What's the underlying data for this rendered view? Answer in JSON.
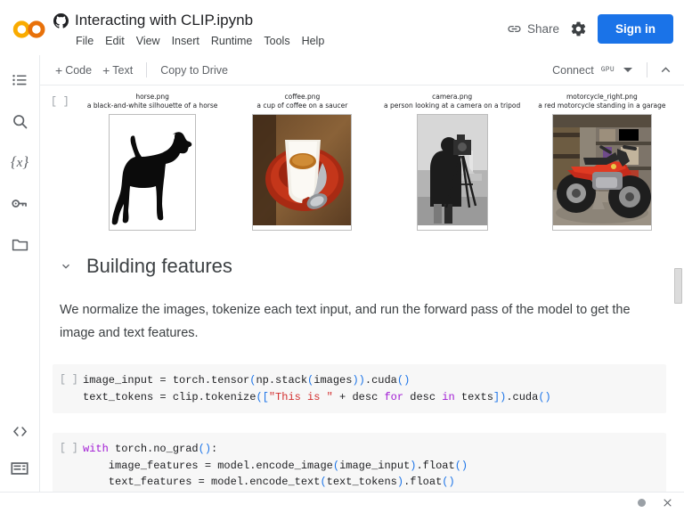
{
  "app": {
    "logo_name": "colab-logo",
    "accent_blue": "#1a73e8",
    "logo_orange": "#f9ab00"
  },
  "header": {
    "doc_title": "Interacting with CLIP.ipynb",
    "github_icon": "github-icon",
    "menus": [
      "File",
      "Edit",
      "View",
      "Insert",
      "Runtime",
      "Tools",
      "Help"
    ],
    "share_label": "Share",
    "share_icon": "link-icon",
    "settings_icon": "gear-icon",
    "signin_label": "Sign in"
  },
  "toolbar": {
    "add_code_label": "Code",
    "add_text_label": "Text",
    "plus_symbol": "+",
    "copy_to_drive_label": "Copy to Drive",
    "connect_label": "Connect",
    "gpu_badge": "GPU",
    "dropdown_icon": "chevron-down-icon",
    "collapse_icon": "chevron-up-icon"
  },
  "sidebar": {
    "items": [
      {
        "name": "table-of-contents-icon",
        "label": "Table of contents"
      },
      {
        "name": "search-icon",
        "label": "Search"
      },
      {
        "name": "variables-icon",
        "label": "Variables"
      },
      {
        "name": "secrets-key-icon",
        "label": "Secrets"
      },
      {
        "name": "files-folder-icon",
        "label": "Files"
      }
    ],
    "bottom_items": [
      {
        "name": "code-snippets-icon",
        "label": "Code snippets"
      },
      {
        "name": "terminal-icon",
        "label": "Terminal"
      }
    ]
  },
  "notebook": {
    "output_cell": {
      "prompt": "[ ]",
      "images": [
        {
          "filename": "horse.png",
          "caption": "a black-and-white silhouette of a horse",
          "kind": "horse-silhouette"
        },
        {
          "filename": "coffee.png",
          "caption": "a cup of coffee on a saucer",
          "kind": "coffee-cup"
        },
        {
          "filename": "camera.png",
          "caption": "a person looking at a camera on a tripod",
          "kind": "camera-person"
        },
        {
          "filename": "motorcycle_right.png",
          "caption": "a red motorcycle standing in a garage",
          "kind": "motorcycle"
        }
      ]
    },
    "markdown_section": {
      "collapse_icon": "chevron-down-icon",
      "heading": "Building features",
      "paragraph": "We normalize the images, tokenize each text input, and run the forward pass of the model to get the image and text features."
    },
    "code_cells": [
      {
        "prompt": "[ ]",
        "lines": [
          [
            {
              "t": "image_input = torch.tensor",
              "c": "plain"
            },
            {
              "t": "(",
              "c": "paren"
            },
            {
              "t": "np.stack",
              "c": "plain"
            },
            {
              "t": "(",
              "c": "paren"
            },
            {
              "t": "images",
              "c": "plain"
            },
            {
              "t": "))",
              "c": "paren"
            },
            {
              "t": ".cuda",
              "c": "plain"
            },
            {
              "t": "()",
              "c": "paren"
            }
          ],
          [
            {
              "t": "text_tokens = clip.tokenize",
              "c": "plain"
            },
            {
              "t": "([",
              "c": "paren"
            },
            {
              "t": "\"This is \"",
              "c": "string"
            },
            {
              "t": " + desc ",
              "c": "plain"
            },
            {
              "t": "for",
              "c": "keyword"
            },
            {
              "t": " desc ",
              "c": "plain"
            },
            {
              "t": "in",
              "c": "keyword"
            },
            {
              "t": " texts",
              "c": "plain"
            },
            {
              "t": "])",
              "c": "paren"
            },
            {
              "t": ".cuda",
              "c": "plain"
            },
            {
              "t": "()",
              "c": "paren"
            }
          ]
        ]
      },
      {
        "prompt": "[ ]",
        "lines": [
          [
            {
              "t": "with",
              "c": "keyword"
            },
            {
              "t": " torch.no_grad",
              "c": "plain"
            },
            {
              "t": "()",
              "c": "paren"
            },
            {
              "t": ":",
              "c": "plain"
            }
          ],
          [
            {
              "t": "    image_features = model.encode_image",
              "c": "plain"
            },
            {
              "t": "(",
              "c": "paren"
            },
            {
              "t": "image_input",
              "c": "plain"
            },
            {
              "t": ")",
              "c": "paren"
            },
            {
              "t": ".float",
              "c": "plain"
            },
            {
              "t": "()",
              "c": "paren"
            }
          ],
          [
            {
              "t": "    text_features = model.encode_text",
              "c": "plain"
            },
            {
              "t": "(",
              "c": "paren"
            },
            {
              "t": "text_tokens",
              "c": "plain"
            },
            {
              "t": ")",
              "c": "paren"
            },
            {
              "t": ".float",
              "c": "plain"
            },
            {
              "t": "()",
              "c": "paren"
            }
          ]
        ]
      }
    ]
  },
  "statusbar": {
    "dot_name": "resource-status-dot",
    "close_icon": "close-icon"
  }
}
